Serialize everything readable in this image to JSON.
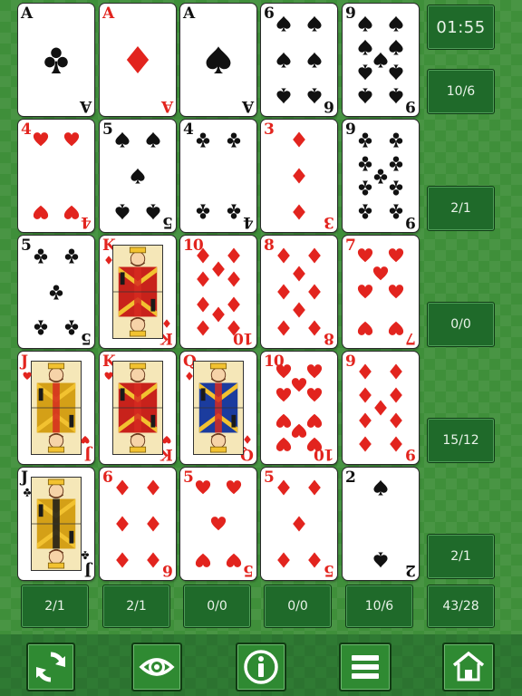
{
  "colors": {
    "red": "#e2241e",
    "black": "#111111",
    "table_green": "#3f8f3a",
    "counter_bg": "#1f6a2a"
  },
  "cards": [
    [
      {
        "rank": "A",
        "suit": "clubs"
      },
      {
        "rank": "A",
        "suit": "diamonds"
      },
      {
        "rank": "A",
        "suit": "spades"
      },
      {
        "rank": "6",
        "suit": "spades"
      },
      {
        "rank": "9",
        "suit": "spades"
      }
    ],
    [
      {
        "rank": "4",
        "suit": "hearts"
      },
      {
        "rank": "5",
        "suit": "spades"
      },
      {
        "rank": "4",
        "suit": "clubs"
      },
      {
        "rank": "3",
        "suit": "diamonds"
      },
      {
        "rank": "9",
        "suit": "clubs"
      }
    ],
    [
      {
        "rank": "5",
        "suit": "clubs"
      },
      {
        "rank": "K",
        "suit": "diamonds"
      },
      {
        "rank": "10",
        "suit": "diamonds"
      },
      {
        "rank": "8",
        "suit": "diamonds"
      },
      {
        "rank": "7",
        "suit": "hearts"
      }
    ],
    [
      {
        "rank": "J",
        "suit": "hearts"
      },
      {
        "rank": "K",
        "suit": "hearts"
      },
      {
        "rank": "Q",
        "suit": "diamonds"
      },
      {
        "rank": "10",
        "suit": "hearts"
      },
      {
        "rank": "9",
        "suit": "diamonds"
      }
    ],
    [
      {
        "rank": "J",
        "suit": "clubs"
      },
      {
        "rank": "6",
        "suit": "diamonds"
      },
      {
        "rank": "5",
        "suit": "hearts"
      },
      {
        "rank": "5",
        "suit": "diamonds"
      },
      {
        "rank": "2",
        "suit": "spades"
      }
    ]
  ],
  "timer": "01:55",
  "row_scores": [
    "10/6",
    "2/1",
    "0/0",
    "15/12",
    "2/1"
  ],
  "column_scores": [
    "2/1",
    "2/1",
    "0/0",
    "0/0",
    "10/6"
  ],
  "total_score": "43/28",
  "toolbar": [
    {
      "name": "new-deal",
      "icon": "refresh-icon"
    },
    {
      "name": "peek",
      "icon": "eye-icon"
    },
    {
      "name": "info",
      "icon": "info-icon"
    },
    {
      "name": "menu",
      "icon": "menu-icon"
    },
    {
      "name": "home",
      "icon": "home-icon"
    }
  ]
}
